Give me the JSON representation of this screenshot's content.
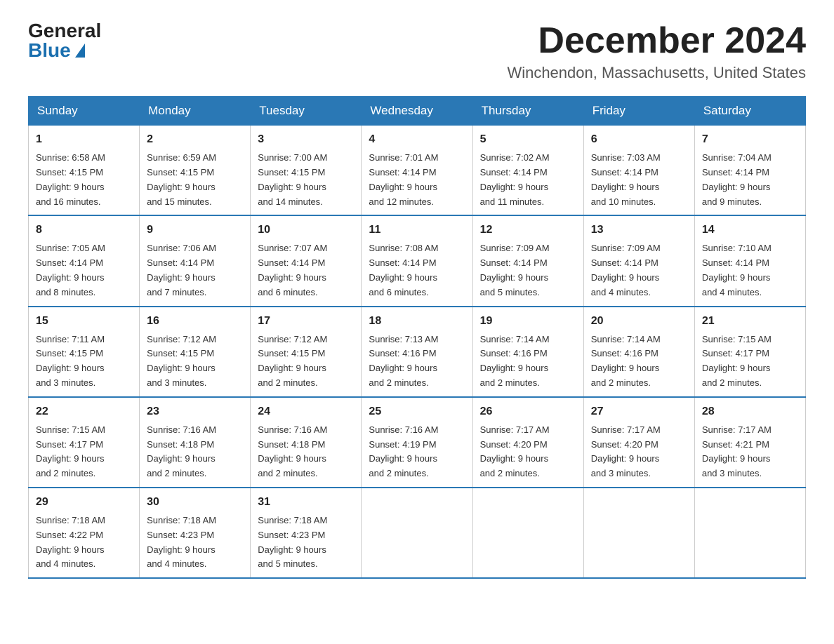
{
  "logo": {
    "general": "General",
    "blue": "Blue"
  },
  "title": {
    "month": "December 2024",
    "location": "Winchendon, Massachusetts, United States"
  },
  "headers": [
    "Sunday",
    "Monday",
    "Tuesday",
    "Wednesday",
    "Thursday",
    "Friday",
    "Saturday"
  ],
  "weeks": [
    [
      {
        "day": "1",
        "sunrise": "6:58 AM",
        "sunset": "4:15 PM",
        "daylight": "9 hours and 16 minutes."
      },
      {
        "day": "2",
        "sunrise": "6:59 AM",
        "sunset": "4:15 PM",
        "daylight": "9 hours and 15 minutes."
      },
      {
        "day": "3",
        "sunrise": "7:00 AM",
        "sunset": "4:15 PM",
        "daylight": "9 hours and 14 minutes."
      },
      {
        "day": "4",
        "sunrise": "7:01 AM",
        "sunset": "4:14 PM",
        "daylight": "9 hours and 12 minutes."
      },
      {
        "day": "5",
        "sunrise": "7:02 AM",
        "sunset": "4:14 PM",
        "daylight": "9 hours and 11 minutes."
      },
      {
        "day": "6",
        "sunrise": "7:03 AM",
        "sunset": "4:14 PM",
        "daylight": "9 hours and 10 minutes."
      },
      {
        "day": "7",
        "sunrise": "7:04 AM",
        "sunset": "4:14 PM",
        "daylight": "9 hours and 9 minutes."
      }
    ],
    [
      {
        "day": "8",
        "sunrise": "7:05 AM",
        "sunset": "4:14 PM",
        "daylight": "9 hours and 8 minutes."
      },
      {
        "day": "9",
        "sunrise": "7:06 AM",
        "sunset": "4:14 PM",
        "daylight": "9 hours and 7 minutes."
      },
      {
        "day": "10",
        "sunrise": "7:07 AM",
        "sunset": "4:14 PM",
        "daylight": "9 hours and 6 minutes."
      },
      {
        "day": "11",
        "sunrise": "7:08 AM",
        "sunset": "4:14 PM",
        "daylight": "9 hours and 6 minutes."
      },
      {
        "day": "12",
        "sunrise": "7:09 AM",
        "sunset": "4:14 PM",
        "daylight": "9 hours and 5 minutes."
      },
      {
        "day": "13",
        "sunrise": "7:09 AM",
        "sunset": "4:14 PM",
        "daylight": "9 hours and 4 minutes."
      },
      {
        "day": "14",
        "sunrise": "7:10 AM",
        "sunset": "4:14 PM",
        "daylight": "9 hours and 4 minutes."
      }
    ],
    [
      {
        "day": "15",
        "sunrise": "7:11 AM",
        "sunset": "4:15 PM",
        "daylight": "9 hours and 3 minutes."
      },
      {
        "day": "16",
        "sunrise": "7:12 AM",
        "sunset": "4:15 PM",
        "daylight": "9 hours and 3 minutes."
      },
      {
        "day": "17",
        "sunrise": "7:12 AM",
        "sunset": "4:15 PM",
        "daylight": "9 hours and 2 minutes."
      },
      {
        "day": "18",
        "sunrise": "7:13 AM",
        "sunset": "4:16 PM",
        "daylight": "9 hours and 2 minutes."
      },
      {
        "day": "19",
        "sunrise": "7:14 AM",
        "sunset": "4:16 PM",
        "daylight": "9 hours and 2 minutes."
      },
      {
        "day": "20",
        "sunrise": "7:14 AM",
        "sunset": "4:16 PM",
        "daylight": "9 hours and 2 minutes."
      },
      {
        "day": "21",
        "sunrise": "7:15 AM",
        "sunset": "4:17 PM",
        "daylight": "9 hours and 2 minutes."
      }
    ],
    [
      {
        "day": "22",
        "sunrise": "7:15 AM",
        "sunset": "4:17 PM",
        "daylight": "9 hours and 2 minutes."
      },
      {
        "day": "23",
        "sunrise": "7:16 AM",
        "sunset": "4:18 PM",
        "daylight": "9 hours and 2 minutes."
      },
      {
        "day": "24",
        "sunrise": "7:16 AM",
        "sunset": "4:18 PM",
        "daylight": "9 hours and 2 minutes."
      },
      {
        "day": "25",
        "sunrise": "7:16 AM",
        "sunset": "4:19 PM",
        "daylight": "9 hours and 2 minutes."
      },
      {
        "day": "26",
        "sunrise": "7:17 AM",
        "sunset": "4:20 PM",
        "daylight": "9 hours and 2 minutes."
      },
      {
        "day": "27",
        "sunrise": "7:17 AM",
        "sunset": "4:20 PM",
        "daylight": "9 hours and 3 minutes."
      },
      {
        "day": "28",
        "sunrise": "7:17 AM",
        "sunset": "4:21 PM",
        "daylight": "9 hours and 3 minutes."
      }
    ],
    [
      {
        "day": "29",
        "sunrise": "7:18 AM",
        "sunset": "4:22 PM",
        "daylight": "9 hours and 4 minutes."
      },
      {
        "day": "30",
        "sunrise": "7:18 AM",
        "sunset": "4:23 PM",
        "daylight": "9 hours and 4 minutes."
      },
      {
        "day": "31",
        "sunrise": "7:18 AM",
        "sunset": "4:23 PM",
        "daylight": "9 hours and 5 minutes."
      },
      null,
      null,
      null,
      null
    ]
  ],
  "labels": {
    "sunrise": "Sunrise:",
    "sunset": "Sunset:",
    "daylight": "Daylight:"
  }
}
